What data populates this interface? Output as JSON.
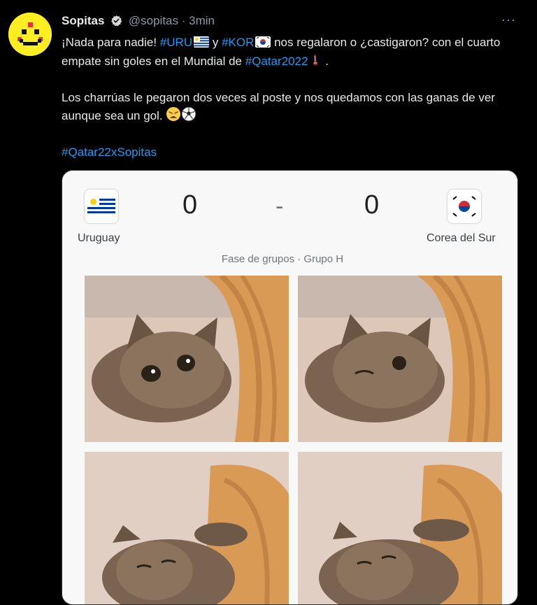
{
  "tweet": {
    "author_name": "Sopitas",
    "handle": "@sopitas",
    "separator": "·",
    "time": "3min",
    "more": "···",
    "text": {
      "l1_a": "¡Nada para nadie! ",
      "tag_uru": "#URU",
      "l1_b": " y ",
      "tag_kor": "#KOR",
      "l1_c": " nos regalaron o ¿castigaron? con el cuarto empate sin goles en el Mundial de ",
      "tag_qatar": "#Qatar2022",
      "l1_d": " .",
      "p2": "Los charrúas le pegaron dos veces al poste y nos quedamos con las ganas de ver aunque sea un gol. ",
      "tag_final": "#Qatar22xSopitas"
    }
  },
  "scoreboard": {
    "home_team": "Uruguay",
    "away_team": "Corea del Sur",
    "home_score": "0",
    "away_score": "0",
    "dash": "-",
    "stage": "Fase de grupos · Grupo H"
  },
  "colors": {
    "background": "#000000",
    "hashtag": "#1d9bf0",
    "avatar": "#fcee21"
  },
  "icons": [
    "verified-badge-icon",
    "more-options-icon",
    "uruguay-flag-icon",
    "korea-flag-icon",
    "trophy-icon",
    "weary-face-icon",
    "soccer-ball-icon"
  ]
}
